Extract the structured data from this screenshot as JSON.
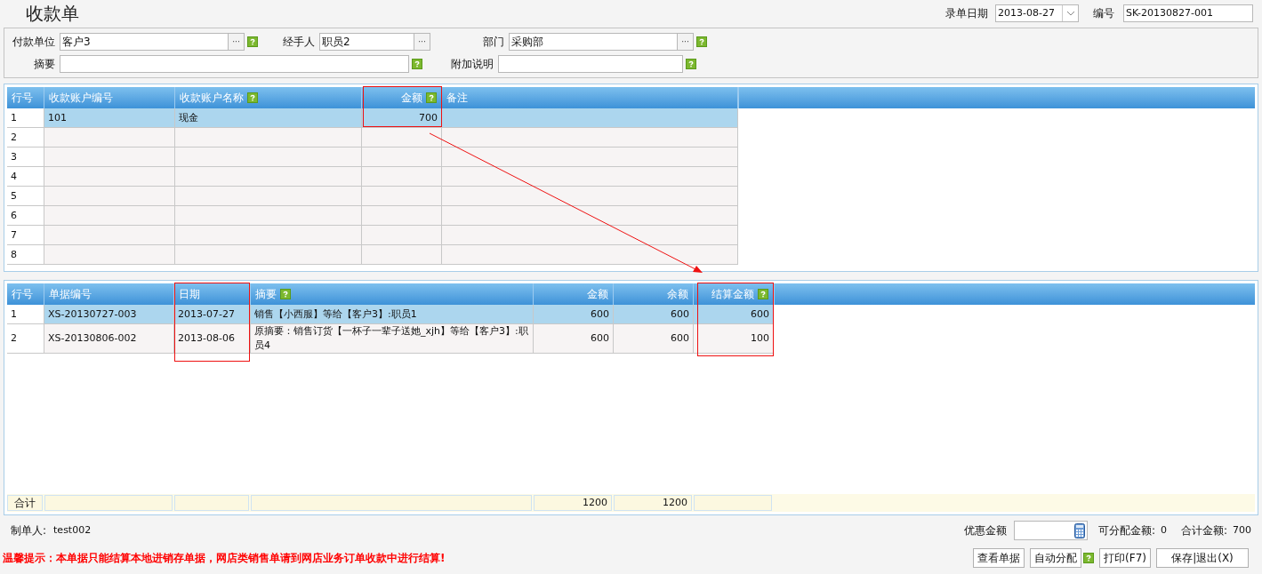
{
  "title": "收款单",
  "header": {
    "date_label": "录单日期",
    "date": "2013-08-27",
    "number_label": "编号",
    "number": "SK-20130827-001"
  },
  "form_rows": [
    [
      {
        "kind": "lookup",
        "label": "付款单位",
        "value": "客户3",
        "help": true
      },
      {
        "kind": "lookup",
        "label": "经手人",
        "value": "职员2",
        "help": false
      },
      {
        "kind": "lookup",
        "label": "部门",
        "value": "采购部",
        "help": true
      }
    ],
    [
      {
        "kind": "text",
        "label": "摘要",
        "help": true
      },
      {
        "kind": "text",
        "label": "附加说明",
        "help": true
      }
    ]
  ],
  "lookup_button": "···",
  "accounts_grid": {
    "columns": [
      {
        "label": "行号",
        "help": false,
        "kind": "text"
      },
      {
        "label": "收款账户编号",
        "help": false,
        "kind": "text"
      },
      {
        "label": "收款账户名称",
        "help": true,
        "kind": "text"
      },
      {
        "label": "金额",
        "help": true,
        "kind": "amount"
      },
      {
        "label": "备注",
        "help": false,
        "kind": "text"
      }
    ],
    "rows": [
      {
        "selected": true,
        "cells": [
          "1",
          "101",
          "现金",
          "700",
          null
        ]
      },
      {
        "selected": false,
        "cells": [
          "2",
          null,
          null,
          null,
          null
        ]
      },
      {
        "selected": false,
        "cells": [
          "3",
          null,
          null,
          null,
          null
        ]
      },
      {
        "selected": false,
        "cells": [
          "4",
          null,
          null,
          null,
          null
        ]
      },
      {
        "selected": false,
        "cells": [
          "5",
          null,
          null,
          null,
          null
        ]
      },
      {
        "selected": false,
        "cells": [
          "6",
          null,
          null,
          null,
          null
        ]
      },
      {
        "selected": false,
        "cells": [
          "7",
          null,
          null,
          null,
          null
        ]
      },
      {
        "selected": false,
        "cells": [
          "8",
          null,
          null,
          null,
          null
        ]
      }
    ]
  },
  "bills_grid": {
    "columns": [
      {
        "label": "行号",
        "help": false,
        "kind": "text"
      },
      {
        "label": "单据编号",
        "help": false,
        "kind": "text"
      },
      {
        "label": "日期",
        "help": false,
        "kind": "text"
      },
      {
        "label": "摘要",
        "help": true,
        "kind": "text"
      },
      {
        "label": "金额",
        "help": false,
        "kind": "amount"
      },
      {
        "label": "余额",
        "help": false,
        "kind": "amount"
      },
      {
        "label": "结算金额",
        "help": true,
        "kind": "amount"
      }
    ],
    "rows": [
      {
        "selected": true,
        "cells": [
          "1",
          "XS-20130727-003",
          "2013-07-27",
          "销售【小西服】等给【客户3】:职员1",
          "600",
          "600",
          "600"
        ]
      },
      {
        "selected": false,
        "cells": [
          "2",
          "XS-20130806-002",
          "2013-08-06",
          "原摘要：销售订货【一杯子一辈子送她_xjh】等给【客户3】:职员4",
          "600",
          "600",
          "100"
        ]
      }
    ],
    "totals": {
      "label": "合计",
      "amount": "1200",
      "balance": "1200"
    }
  },
  "footer": {
    "maker_label": "制单人:",
    "maker": "test002",
    "discount_label": "优惠金额",
    "assignable_label": "可分配金额:",
    "assignable": "0",
    "total_label": "合计金额:",
    "total": "700",
    "warning": "温馨提示：本单据只能结算本地进销存单据，网店类销售单请到网店业务订单收款中进行结算!",
    "buttons": [
      {
        "label": "查看单据",
        "help": false
      },
      {
        "label": "自动分配",
        "help": true
      },
      {
        "label": "打印(F7)",
        "help": false
      },
      {
        "label": "保存|退出(X)",
        "help": false
      }
    ]
  }
}
